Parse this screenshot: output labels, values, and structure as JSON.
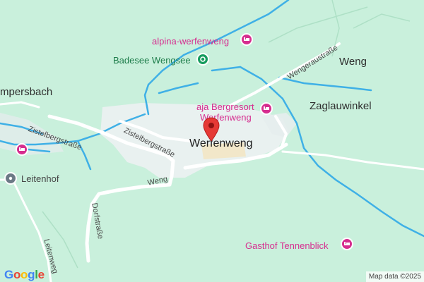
{
  "map": {
    "place_labels": {
      "weng": "Weng",
      "zaglauwinkel": "Zaglauwinkel",
      "mpersbach": "mpersbach",
      "town": "Werfenweng"
    },
    "road_labels": {
      "zistelbergstrasse_1": "Zistelbergstraße",
      "zistelbergstrasse_2": "Zistelbergstraße",
      "wengeraustrasse": "Wengeraustraße",
      "weng_road": "Weng",
      "dorfstrasse": "Dorfstraße",
      "leitenweg": "Leitenweg"
    },
    "pois": {
      "alpina": "alpina-werfenweng",
      "badesee": "Badesee Wengsee",
      "aja_line1": "aja Bergresort",
      "aja_line2": "Werfenweng",
      "leitenhof": "Leitenhof",
      "tennenblick": "Gasthof Tennenblick"
    },
    "colors": {
      "terrain": "#c9f0dc",
      "river": "#3fb0e6",
      "road": "#ffffff",
      "hotel_marker": "#d62d8f",
      "park_marker": "#169c5e",
      "location_marker": "#6c7a86",
      "pin": "#e53935"
    },
    "logo": [
      "G",
      "o",
      "o",
      "g",
      "l",
      "e"
    ],
    "logo_colors": [
      "#4285F4",
      "#EA4335",
      "#FBBC05",
      "#4285F4",
      "#34A853",
      "#EA4335"
    ],
    "attribution": "Map data ©2025"
  }
}
